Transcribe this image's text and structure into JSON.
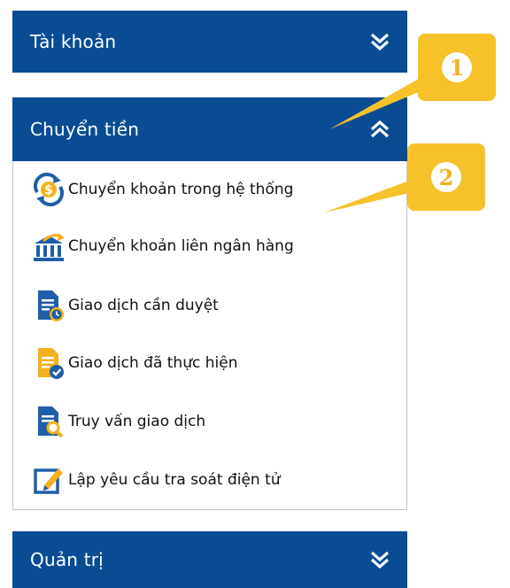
{
  "panels": {
    "account": {
      "label": "Tài khoản",
      "state": "collapsed"
    },
    "transfer": {
      "label": "Chuyển tiền",
      "state": "expanded"
    },
    "admin": {
      "label": "Quản trị",
      "state": "collapsed"
    }
  },
  "transfer_menu": {
    "items": [
      {
        "label": "Chuyển khoản trong hệ thống",
        "icon": "dollar-refresh-icon"
      },
      {
        "label": "Chuyển khoản liên ngân hàng",
        "icon": "bank-transfer-icon"
      },
      {
        "label": "Giao dịch cần duyệt",
        "icon": "document-pending-icon"
      },
      {
        "label": "Giao dịch đã thực hiện",
        "icon": "document-check-icon"
      },
      {
        "label": "Truy vấn giao dịch",
        "icon": "document-search-icon"
      },
      {
        "label": "Lập yêu cầu tra soát điện tử",
        "icon": "edit-form-icon"
      }
    ]
  },
  "callouts": [
    {
      "number": "1"
    },
    {
      "number": "2"
    }
  ],
  "colors": {
    "header_bg": "#0a4c93",
    "header_text": "#ffffff",
    "callout": "#f7c229",
    "menu_border": "#b9c7d8"
  }
}
